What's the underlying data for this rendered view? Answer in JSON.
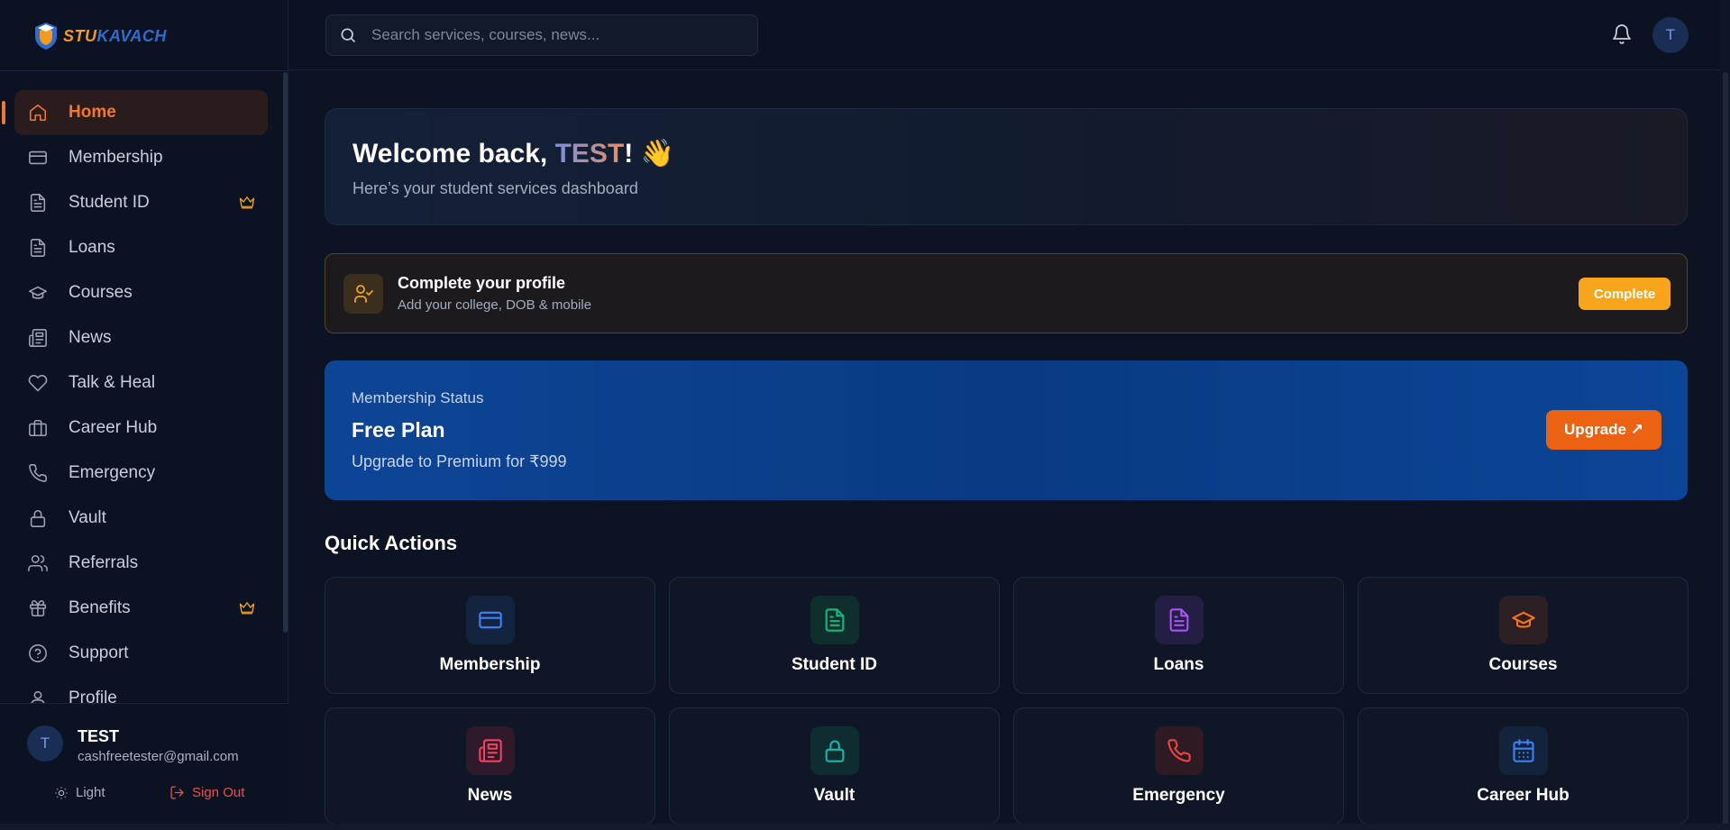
{
  "brand": {
    "part1": "STU",
    "part2": "KAVACH"
  },
  "search": {
    "placeholder": "Search services, courses, news..."
  },
  "header": {
    "avatar_initial": "T"
  },
  "sidebar": {
    "items": [
      {
        "label": "Home",
        "icon": "home-icon",
        "active": true,
        "premium": false
      },
      {
        "label": "Membership",
        "icon": "card-icon",
        "active": false,
        "premium": false
      },
      {
        "label": "Student ID",
        "icon": "document-icon",
        "active": false,
        "premium": true
      },
      {
        "label": "Loans",
        "icon": "document-icon",
        "active": false,
        "premium": false
      },
      {
        "label": "Courses",
        "icon": "graduation-cap-icon",
        "active": false,
        "premium": false
      },
      {
        "label": "News",
        "icon": "newspaper-icon",
        "active": false,
        "premium": false
      },
      {
        "label": "Talk & Heal",
        "icon": "heart-icon",
        "active": false,
        "premium": false
      },
      {
        "label": "Career Hub",
        "icon": "briefcase-icon",
        "active": false,
        "premium": false
      },
      {
        "label": "Emergency",
        "icon": "phone-icon",
        "active": false,
        "premium": false
      },
      {
        "label": "Vault",
        "icon": "lock-icon",
        "active": false,
        "premium": false
      },
      {
        "label": "Referrals",
        "icon": "users-icon",
        "active": false,
        "premium": false
      },
      {
        "label": "Benefits",
        "icon": "gift-icon",
        "active": false,
        "premium": true
      },
      {
        "label": "Support",
        "icon": "help-circle-icon",
        "active": false,
        "premium": false
      },
      {
        "label": "Profile",
        "icon": "user-icon",
        "active": false,
        "premium": false
      }
    ]
  },
  "user": {
    "initial": "T",
    "name": "TEST",
    "email": "cashfreetester@gmail.com",
    "theme_label": "Light",
    "signout_label": "Sign Out"
  },
  "welcome": {
    "prefix": "Welcome back, ",
    "name": "TEST",
    "suffix": "! 👋",
    "subtitle": "Here’s your student services dashboard"
  },
  "profile_card": {
    "title": "Complete your profile",
    "subtitle": "Add your college, DOB & mobile",
    "button": "Complete"
  },
  "membership": {
    "label": "Membership Status",
    "plan": "Free Plan",
    "subtitle": "Upgrade to Premium for ₹999",
    "button": "Upgrade ↗"
  },
  "quick_actions": {
    "title": "Quick Actions",
    "items": [
      {
        "label": "Membership",
        "icon": "card-icon",
        "color": "#3b82f6",
        "bg": "#14243f"
      },
      {
        "label": "Student ID",
        "icon": "document-icon",
        "color": "#10b981",
        "bg": "#0f2f2c"
      },
      {
        "label": "Loans",
        "icon": "document-icon",
        "color": "#a855f7",
        "bg": "#241d44"
      },
      {
        "label": "Courses",
        "icon": "graduation-cap-icon",
        "color": "#f97316",
        "bg": "#2c2024"
      },
      {
        "label": "News",
        "icon": "newspaper-icon",
        "color": "#f43f5e",
        "bg": "#2e1a2b"
      },
      {
        "label": "Vault",
        "icon": "lock-icon",
        "color": "#14b8a6",
        "bg": "#0f2d30"
      },
      {
        "label": "Emergency",
        "icon": "phone-icon",
        "color": "#ef4444",
        "bg": "#2e1a22"
      },
      {
        "label": "Career Hub",
        "icon": "calendar-icon",
        "color": "#3b82f6",
        "bg": "#14233c"
      }
    ]
  },
  "colors": {
    "accent": "#f3782b",
    "premium": "#f0a21a",
    "membership_bg": "#0d4596"
  }
}
